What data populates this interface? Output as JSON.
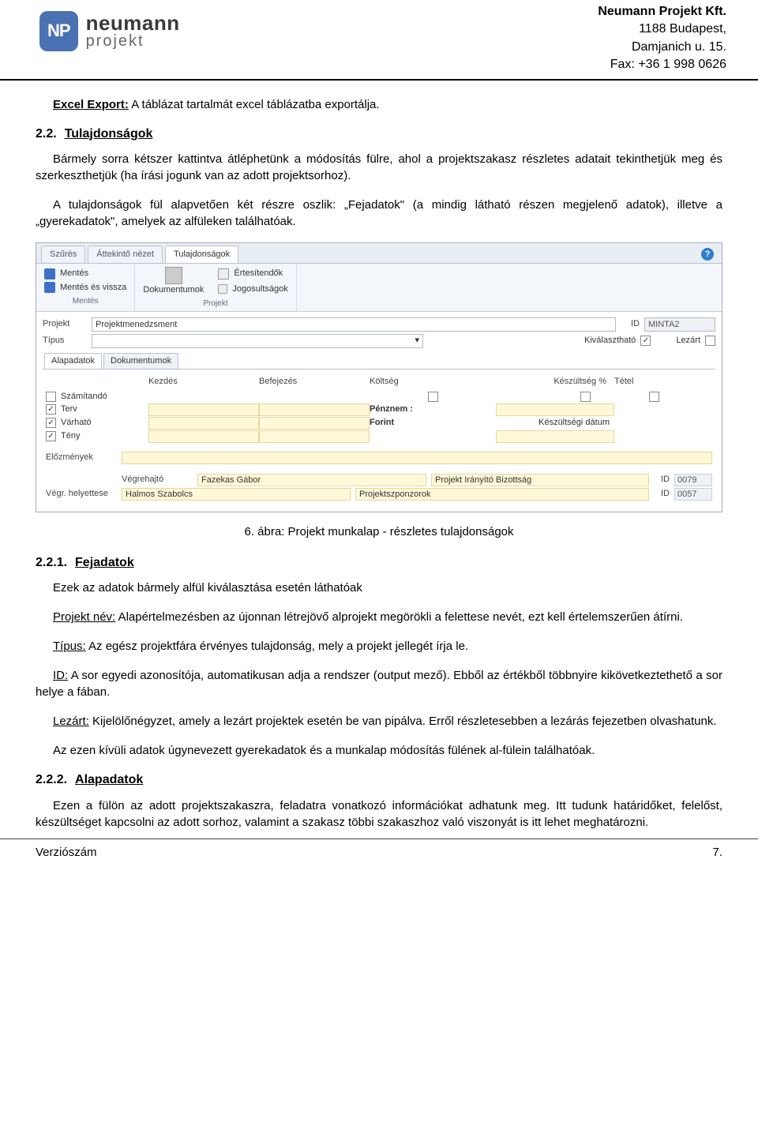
{
  "header": {
    "company_name": "Neumann Projekt Kft.",
    "addr1": "1188 Budapest,",
    "addr2": "Damjanich u. 15.",
    "fax": "Fax: +36 1 998 0626",
    "logo_badge": "NP",
    "logo_t1": "neumann",
    "logo_t2": "projekt"
  },
  "body": {
    "excel_label": "Excel Export:",
    "excel_text": " A táblázat tartalmát excel táblázatba exportálja.",
    "sec22_num": "2.2.",
    "sec22_title": "Tulajdonságok",
    "p1": "Bármely sorra kétszer kattintva átléphetünk a módosítás fülre, ahol a projektszakasz részletes adatait tekinthetjük meg és szerkeszthetjük (ha írási jogunk van az adott projektsorhoz).",
    "p2": "A tulajdonságok fül alapvetően két részre oszlik: „Fejadatok\" (a mindig látható részen megjelenő adatok), illetve a „gyerekadatok\", amelyek az alfüleken találhatóak.",
    "caption": "6. ábra: Projekt munkalap - részletes tulajdonságok",
    "sec221_num": "2.2.1.",
    "sec221_title": "Fejadatok",
    "p3": "Ezek az adatok bármely alfül kiválasztása esetén láthatóak",
    "p4a": "Projekt név:",
    "p4b": " Alapértelmezésben az újonnan létrejövő alprojekt megörökli a felettese nevét, ezt kell értelemszerűen átírni.",
    "p5a": "Típus:",
    "p5b": " Az egész projektfára érvényes tulajdonság, mely a projekt jellegét írja le.",
    "p6a": "ID:",
    "p6b": " A sor egyedi azonosítója, automatikusan adja a rendszer (output mező). Ebből az értékből többnyire kikövetkeztethető a sor helye a fában.",
    "p7a": "Lezárt:",
    "p7b": " Kijelölőnégyzet, amely a lezárt projektek esetén be van pipálva. Erről részletesebben a lezárás fejezetben olvashatunk.",
    "p8": "Az ezen kívüli adatok úgynevezett gyerekadatok és a munkalap módosítás fülének al-fülein találhatóak.",
    "sec222_num": "2.2.2.",
    "sec222_title": "Alapadatok",
    "p9": "Ezen a fülön az adott projektszakaszra, feladatra vonatkozó információkat adhatunk meg. Itt tudunk határidőket, felelőst, készültséget kapcsolni az adott sorhoz, valamint a szakasz többi szakaszhoz való viszonyát is itt lehet meghatározni."
  },
  "shot": {
    "tabs": {
      "t1": "Szűrés",
      "t2": "Áttekintő nézet",
      "t3": "Tulajdonságok"
    },
    "ribbon": {
      "save": "Mentés",
      "saveback": "Mentés és vissza",
      "group1": "Mentés",
      "docs": "Dokumentumok",
      "group2": "Projekt",
      "ertes": "Értesítendők",
      "jogos": "Jogosultságok"
    },
    "form": {
      "lbl_projekt": "Projekt",
      "val_projekt": "Projektmenedzsment",
      "lbl_id": "ID",
      "val_id": "MINTA2",
      "lbl_tipus": "Típus",
      "lbl_kiv": "Kiválasztható",
      "lbl_lezart": "Lezárt"
    },
    "subtabs": {
      "t1": "Alapadatok",
      "t2": "Dokumentumok"
    },
    "grid": {
      "h_kezdes": "Kezdés",
      "h_befejezes": "Befejezés",
      "h_koltseg": "Költség",
      "h_keszultseg": "Készültség %",
      "h_tetel": "Tétel",
      "r_szamitando": "Számítandó",
      "r_terv": "Terv",
      "r_varhato": "Várható",
      "r_teny": "Tény",
      "penznem1": "Pénznem :",
      "penznem2": "Forint",
      "kesz_datum": "Készültségi dátum",
      "elozmenyek": "Előzmények",
      "vegrehajto_lbl": "Végrehajtó",
      "vegrehajto_val": "Fazekas Gábor",
      "vegrhely_lbl": "Végr. helyettese",
      "vegrhely_val": "Halmos Szabolcs",
      "bizottsag": "Projekt Irányító Bizottság",
      "szponzor": "Projektszponzorok",
      "id_lbl": "ID",
      "id1": "0079",
      "id2": "0057"
    }
  },
  "footer": {
    "left": "Verziószám",
    "right": "7."
  }
}
